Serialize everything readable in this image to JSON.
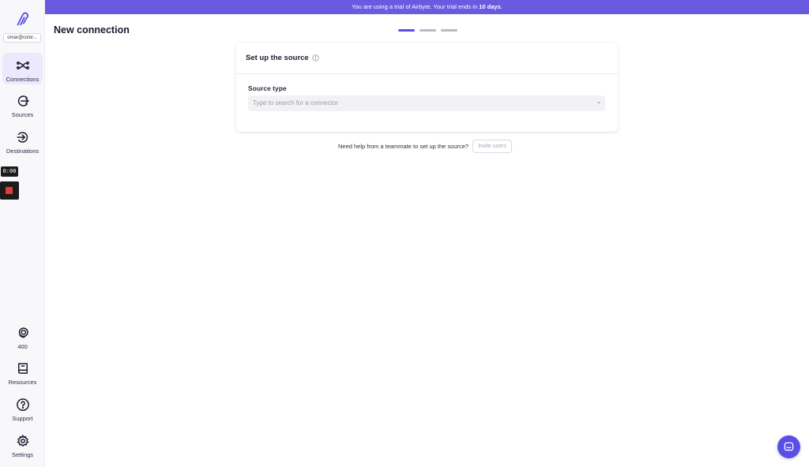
{
  "banner": {
    "prefix": "You are using a trial of Airbyte. Your trial ends in",
    "days": "10 days",
    "suffix": "."
  },
  "sidebar": {
    "workspace": "omar@color...",
    "items": [
      {
        "label": "Connections",
        "icon": "connections-icon",
        "active": true
      },
      {
        "label": "Sources",
        "icon": "sources-icon",
        "active": false
      },
      {
        "label": "Destinations",
        "icon": "destinations-icon",
        "active": false
      }
    ],
    "bottom_items": [
      {
        "label": "400",
        "icon": "credits-icon"
      },
      {
        "label": "Resources",
        "icon": "book-icon"
      },
      {
        "label": "Support",
        "icon": "question-icon"
      },
      {
        "label": "Settings",
        "icon": "gear-icon"
      }
    ]
  },
  "recorder": {
    "time": "0:00"
  },
  "page": {
    "title": "New connection",
    "steps_total": 3,
    "current_step": 1
  },
  "card": {
    "title": "Set up the source",
    "field_label": "Source type",
    "select_placeholder": "Type to search for a connector"
  },
  "help": {
    "text": "Need help from a teammate to set up the source?",
    "invite_label": "Invite users"
  },
  "colors": {
    "accent": "#5b4ee6",
    "banner": "#6a5ae0"
  }
}
